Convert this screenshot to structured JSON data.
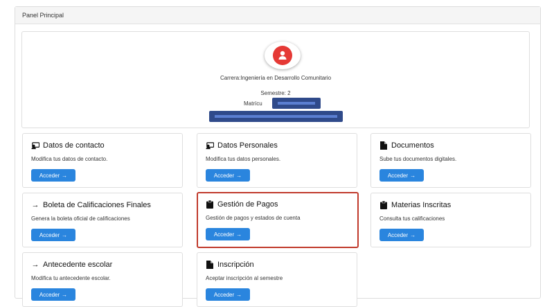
{
  "panel": {
    "title": "Panel Principal"
  },
  "profile": {
    "career_label": "Carrera:",
    "career_value": "Ingeniería en Desarrollo Comunitario",
    "semester_label": "Semestre:",
    "semester_value": "2",
    "matricula_label": "Matrícu"
  },
  "cards": [
    {
      "title": "Datos de contacto",
      "description": "Modifica tus datos de contacto.",
      "button": "Acceder",
      "icon": "contact-card-icon"
    },
    {
      "title": "Datos Personales",
      "description": "Modifica tus datos personales.",
      "button": "Acceder",
      "icon": "contact-card-icon"
    },
    {
      "title": "Documentos",
      "description": "Sube tus documentos digitales.",
      "button": "Acceder",
      "icon": "document-icon"
    },
    {
      "title": "Boleta de Calificaciones Finales",
      "description": "Genera la boleta oficial de calificaciones",
      "button": "Acceder",
      "icon": "arrow-right-icon"
    },
    {
      "title": "Gestión de Pagos",
      "description": "Gestión de pagos y estados de cuenta",
      "button": "Acceder",
      "icon": "clipboard-icon"
    },
    {
      "title": "Materias Inscritas",
      "description": "Consulta tus calificaciones",
      "button": "Acceder",
      "icon": "clipboard-icon"
    },
    {
      "title": "Antecedente escolar",
      "description": "Modifica tu antecedente escolar.",
      "button": "Acceder",
      "icon": "arrow-right-icon"
    },
    {
      "title": "Inscripción",
      "description": "Aceptar inscripción al semestre",
      "button": "Acceder",
      "icon": "document-icon"
    }
  ],
  "colors": {
    "button": "#2a85de",
    "highlight": "#c0392b",
    "avatar": "#e53935"
  }
}
